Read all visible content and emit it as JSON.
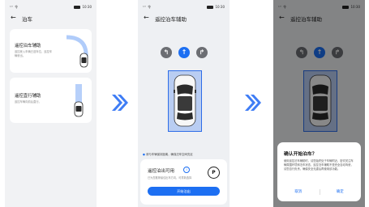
{
  "status": {
    "signal": "ᵃˡˡ 令",
    "time": "10:30"
  },
  "screen1": {
    "title": "泊车",
    "card1": {
      "title": "遥控泊车辅助",
      "desc": "遥控驶入车辆已选车位，遥控车辆驶出。"
    },
    "card2": {
      "title": "遥控直行辅助",
      "desc": "遥控车辆向前后直行。"
    }
  },
  "screen2": {
    "title": "遥控泊车辅助",
    "tip": "请与车辆保持距离，确保泊车空间充足",
    "status_title": "遥控泊出可用",
    "status_desc": "已为您推荐最佳出车方向，可重新选择",
    "gear": "P",
    "start_button": "开始泊出"
  },
  "screen3": {
    "title": "遥控泊车辅助",
    "dialog": {
      "title": "确认开始泊车？",
      "body": "使用遥控泊车辅助时，请您始终处于车辆附近，密切关注车辆周围环境和泊车状态，遥控泊车辅助不是完全自动驾驶，请您自行负责，确保安全无虞后再使用该功能。",
      "cancel": "取消",
      "confirm": "确定"
    }
  },
  "colors": {
    "accent": "#1d6ff2",
    "arrow": "#3f7df5"
  }
}
